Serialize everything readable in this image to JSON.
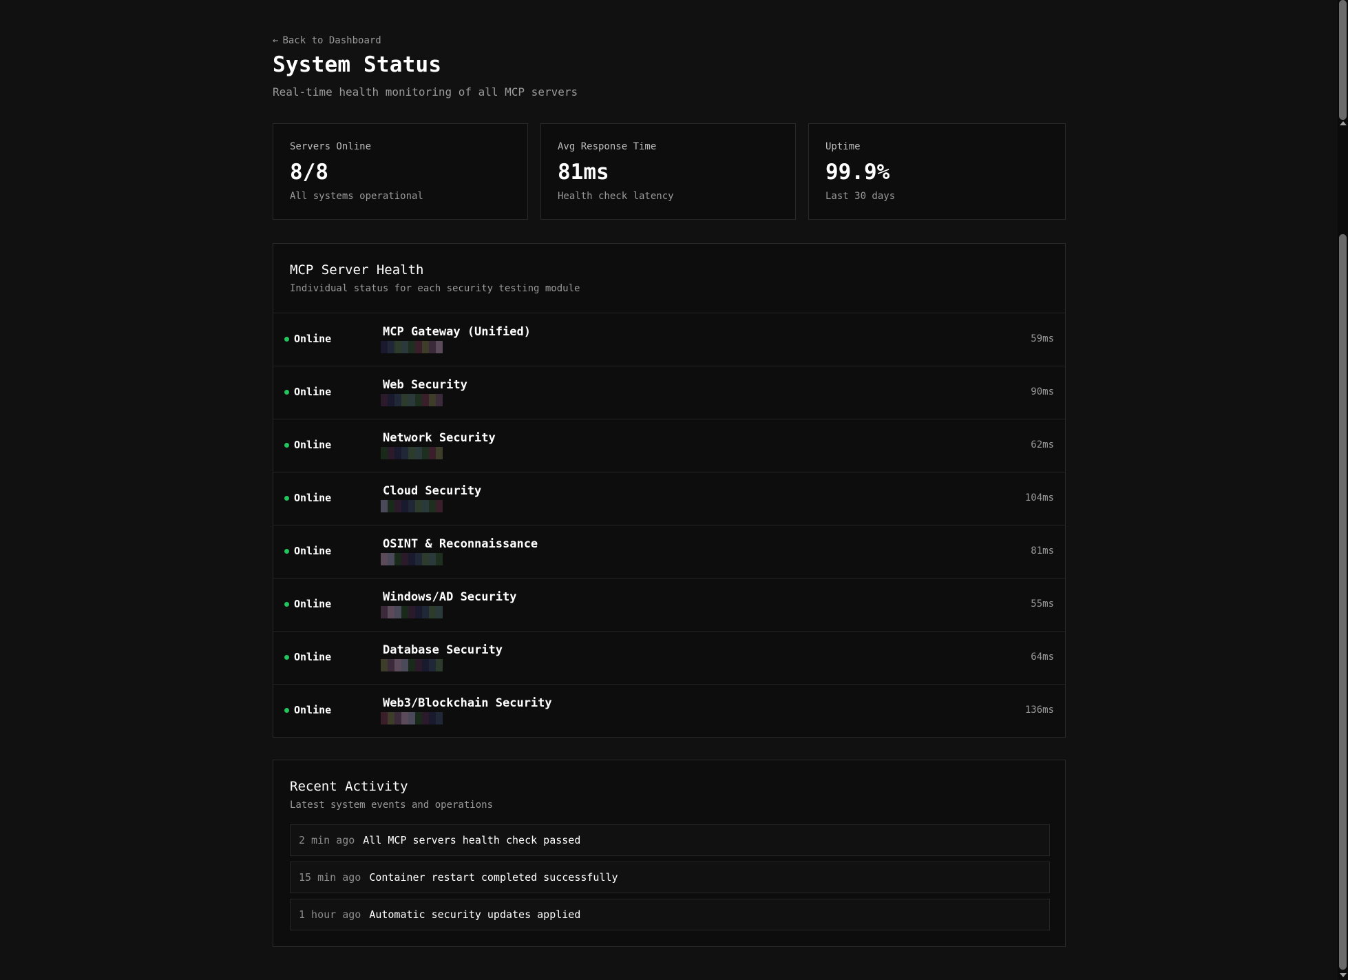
{
  "nav": {
    "back_label": "Back to Dashboard",
    "back_arrow": "←"
  },
  "header": {
    "title": "System Status",
    "subtitle": "Real-time health monitoring of all MCP servers"
  },
  "stats": [
    {
      "label": "Servers Online",
      "value": "8/8",
      "note": "All systems operational"
    },
    {
      "label": "Avg Response Time",
      "value": "81ms",
      "note": "Health check latency"
    },
    {
      "label": "Uptime",
      "value": "99.9%",
      "note": "Last 30 days"
    }
  ],
  "health": {
    "title": "MCP Server Health",
    "description": "Individual status for each security testing module",
    "status_color": "#22c55e",
    "servers": [
      {
        "status": "Online",
        "name": "MCP Gateway (Unified)",
        "latency": "59ms"
      },
      {
        "status": "Online",
        "name": "Web Security",
        "latency": "90ms"
      },
      {
        "status": "Online",
        "name": "Network Security",
        "latency": "62ms"
      },
      {
        "status": "Online",
        "name": "Cloud Security",
        "latency": "104ms"
      },
      {
        "status": "Online",
        "name": "OSINT & Reconnaissance",
        "latency": "81ms"
      },
      {
        "status": "Online",
        "name": "Windows/AD Security",
        "latency": "55ms"
      },
      {
        "status": "Online",
        "name": "Database Security",
        "latency": "64ms"
      },
      {
        "status": "Online",
        "name": "Web3/Blockchain Security",
        "latency": "136ms"
      }
    ]
  },
  "activity": {
    "title": "Recent Activity",
    "description": "Latest system events and operations",
    "items": [
      {
        "time": "2 min ago",
        "text": "All MCP servers health check passed"
      },
      {
        "time": "15 min ago",
        "text": "Container restart completed successfully"
      },
      {
        "time": "1 hour ago",
        "text": "Automatic security updates applied"
      }
    ]
  }
}
